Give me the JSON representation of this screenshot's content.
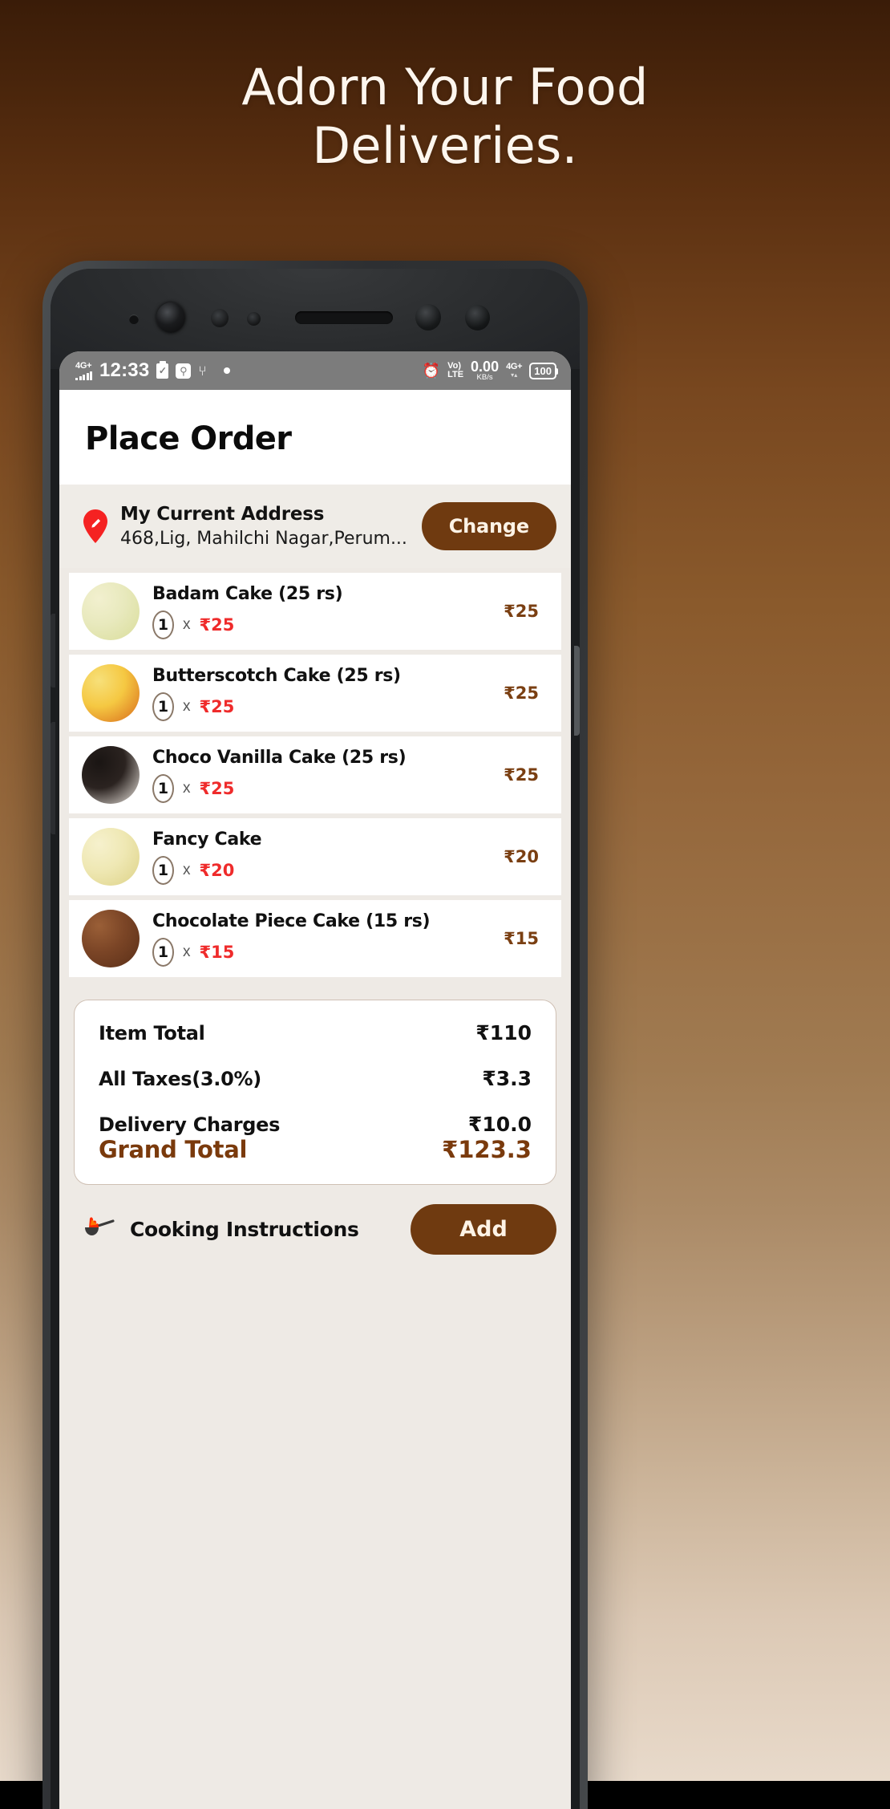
{
  "hero": {
    "line1": "Adorn Your Food",
    "line2": "Deliveries."
  },
  "status_bar": {
    "network_label": "4G",
    "network_plus": "+",
    "time": "12:33",
    "clipboard_icon": "clipboard-check-icon",
    "adb_icon": "android-debug-icon",
    "usb_icon": "usb-icon",
    "recording_dot_icon": "recording-dot-icon",
    "alarm_icon": "alarm-clock-icon",
    "volte_top": "Vo)",
    "volte_bottom": "LTE",
    "data_rate": "0.00",
    "data_unit": "KB/s",
    "network_right": "4G",
    "network_right_plus": "+",
    "signal_triangle": "▾▴",
    "battery": "100"
  },
  "header": {
    "title": "Place Order"
  },
  "address": {
    "pin_icon": "location-pin-edit-icon",
    "title": "My Current Address",
    "line": "468,Lig, Mahilchi Nagar,Perum...",
    "change_label": "Change"
  },
  "cart": {
    "multiply_symbol": "x",
    "items": [
      {
        "name": "Badam Cake (25 rs)",
        "qty": "1",
        "unit_price": "₹25",
        "line_total": "₹25",
        "thumb_colors": [
          "#e8e9bd",
          "#d9dd9a",
          "#f2f0cf"
        ]
      },
      {
        "name": "Butterscotch Cake (25 rs)",
        "qty": "1",
        "unit_price": "₹25",
        "line_total": "₹25",
        "thumb_colors": [
          "#f5c842",
          "#d8691a",
          "#f7e07a"
        ]
      },
      {
        "name": "Choco Vanilla Cake (25 rs)",
        "qty": "1",
        "unit_price": "₹25",
        "line_total": "₹25",
        "thumb_colors": [
          "#2b2320",
          "#efe9e2",
          "#1a1513"
        ]
      },
      {
        "name": "Fancy Cake",
        "qty": "1",
        "unit_price": "₹20",
        "line_total": "₹20",
        "thumb_colors": [
          "#efe8b4",
          "#ddd287",
          "#f6f1cd"
        ]
      },
      {
        "name": "Chocolate Piece Cake (15 rs)",
        "qty": "1",
        "unit_price": "₹15",
        "line_total": "₹15",
        "thumb_colors": [
          "#7b4526",
          "#5a2f18",
          "#9a5f37"
        ]
      }
    ]
  },
  "totals": {
    "rows": [
      {
        "label": "Item Total",
        "value": "₹110"
      },
      {
        "label": "All Taxes(3.0%)",
        "value": "₹3.3"
      },
      {
        "label": "Delivery Charges",
        "value": "₹10.0"
      }
    ],
    "grand": {
      "label": "Grand Total",
      "value": "₹123.3"
    }
  },
  "bottom": {
    "pan_icon": "flaming-pan-icon",
    "cooking_label": "Cooking Instructions",
    "add_label": "Add"
  },
  "colors": {
    "brand_brown": "#6f3a10",
    "accent_red": "#ef2b2b",
    "price_brown": "#7a3f12",
    "screen_bg": "#eeeae5"
  }
}
